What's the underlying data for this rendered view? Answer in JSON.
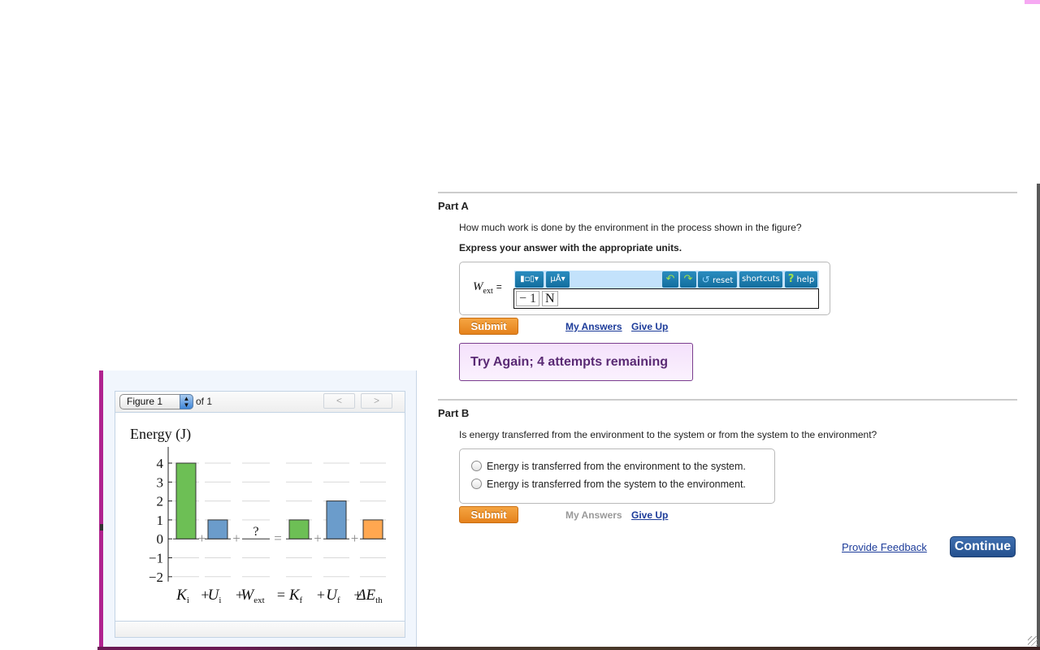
{
  "partA": {
    "title": "Part A",
    "question": "How much work is done by the environment in the process shown in the figure?",
    "instruction": "Express your answer with the appropriate units.",
    "answer_label_var": "W",
    "answer_label_sub": "ext",
    "answer_label_eq": "=",
    "answer_value": "− 1",
    "answer_unit": "N",
    "toolbar": {
      "templates_icon": "fraction-template-icon",
      "units_label": "μÅ",
      "undo_icon": "undo-icon",
      "redo_icon": "redo-icon",
      "reset_label": "reset",
      "shortcuts_label": "shortcuts",
      "help_label": "help"
    },
    "submit_label": "Submit",
    "my_answers_label": "My Answers",
    "give_up_label": "Give Up",
    "feedback": "Try Again; 4 attempts remaining"
  },
  "partB": {
    "title": "Part B",
    "question": "Is energy transferred from the environment to the system or from the system to the environment?",
    "options": [
      "Energy is transferred from the environment to the system.",
      "Energy is transferred from the system to the environment."
    ],
    "submit_label": "Submit",
    "my_answers_label": "My Answers",
    "give_up_label": "Give Up"
  },
  "footer": {
    "provide_feedback_label": "Provide Feedback",
    "continue_label": "Continue"
  },
  "figure": {
    "select_value": "Figure 1",
    "of_label": "of 1",
    "prev_label": "<",
    "next_label": ">"
  },
  "chart_data": {
    "type": "bar",
    "title": "Energy (J)",
    "ylabel": "Energy (J)",
    "ylim": [
      -2,
      4
    ],
    "yticks": [
      4,
      3,
      2,
      1,
      0,
      -1,
      -2
    ],
    "ytick_labels": [
      "4",
      "3",
      "2",
      "1",
      "0",
      "−1",
      "−2"
    ],
    "grid": true,
    "categories": [
      "Ki",
      "Ui",
      "Wext",
      "Kf",
      "Uf",
      "ΔEth"
    ],
    "values": [
      4,
      1,
      null,
      1,
      2,
      1
    ],
    "unknown_label": "?",
    "colors": [
      "#6dbf55",
      "#6b9ccb",
      "#ffffff",
      "#6dbf55",
      "#6b9ccb",
      "#ffa750"
    ],
    "operators": [
      "+",
      "+",
      "=",
      "+",
      "+"
    ],
    "equation": {
      "terms": [
        {
          "main": "K",
          "sub": "i"
        },
        {
          "main": "U",
          "sub": "i"
        },
        {
          "main": "W",
          "sub": "ext"
        },
        {
          "main": "K",
          "sub": "f"
        },
        {
          "main": "U",
          "sub": "f"
        },
        {
          "main": "ΔE",
          "sub": "th"
        }
      ]
    }
  }
}
